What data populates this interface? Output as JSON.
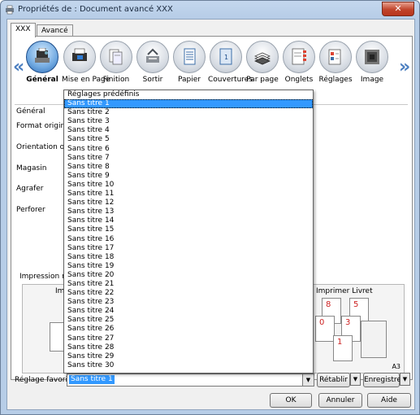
{
  "window": {
    "title": "Propriétés de : Document avancé XXX",
    "close_glyph": "✕"
  },
  "tabs": [
    {
      "label": "XXX"
    },
    {
      "label": "Avancé"
    }
  ],
  "toolbar": {
    "left_arrow": "«",
    "right_arrow": "»",
    "items": [
      {
        "label": "Général",
        "icon": "general-icon",
        "selected": true
      },
      {
        "label": "Mise en Page",
        "icon": "layout-icon"
      },
      {
        "label": "Finition",
        "icon": "finishing-icon"
      },
      {
        "label": "Sortir",
        "icon": "output-icon"
      },
      {
        "label": "Papier",
        "icon": "paper-icon"
      },
      {
        "label": "Couvertures",
        "icon": "covers-icon"
      },
      {
        "label": "Par page",
        "icon": "per-page-icon"
      },
      {
        "label": "Onglets",
        "icon": "tabs-icon"
      },
      {
        "label": "Réglages",
        "icon": "settings-icon"
      },
      {
        "label": "Image",
        "icon": "image-icon"
      }
    ]
  },
  "general": {
    "section_label": "Général",
    "format_original": "Format original",
    "orientation": "Orientation origi",
    "magasin": "Magasin",
    "agrafer": "Agrafer",
    "perforer": "Perforer"
  },
  "quick": {
    "label": "Impression rap",
    "left_title": "Im",
    "right_title": "Imprimer Livret",
    "paper_size": "A3",
    "booklet_numbers": [
      "8",
      "5",
      "0",
      "3",
      "1"
    ]
  },
  "dropdown": {
    "header": "Réglages prédéfinis",
    "items": [
      "Sans titre 1",
      "Sans titre 2",
      "Sans titre 3",
      "Sans titre 4",
      "Sans titre 5",
      "Sans titre 6",
      "Sans titre 7",
      "Sans titre 8",
      "Sans titre 9",
      "Sans titre 10",
      "Sans titre 11",
      "Sans titre 12",
      "Sans titre 13",
      "Sans titre 14",
      "Sans titre 15",
      "Sans titre 16",
      "Sans titre 17",
      "Sans titre 18",
      "Sans titre 19",
      "Sans titre 20",
      "Sans titre 21",
      "Sans titre 22",
      "Sans titre 23",
      "Sans titre 24",
      "Sans titre 25",
      "Sans titre 26",
      "Sans titre 27",
      "Sans titre 28",
      "Sans titre 29",
      "Sans titre 30"
    ],
    "selected_index": 0
  },
  "favorite": {
    "label": "Réglage favori",
    "value": "Sans titre 1",
    "restore": "Rétablir",
    "save": "Enregistrer"
  },
  "buttons": {
    "ok": "OK",
    "cancel": "Annuler",
    "help": "Aide"
  }
}
